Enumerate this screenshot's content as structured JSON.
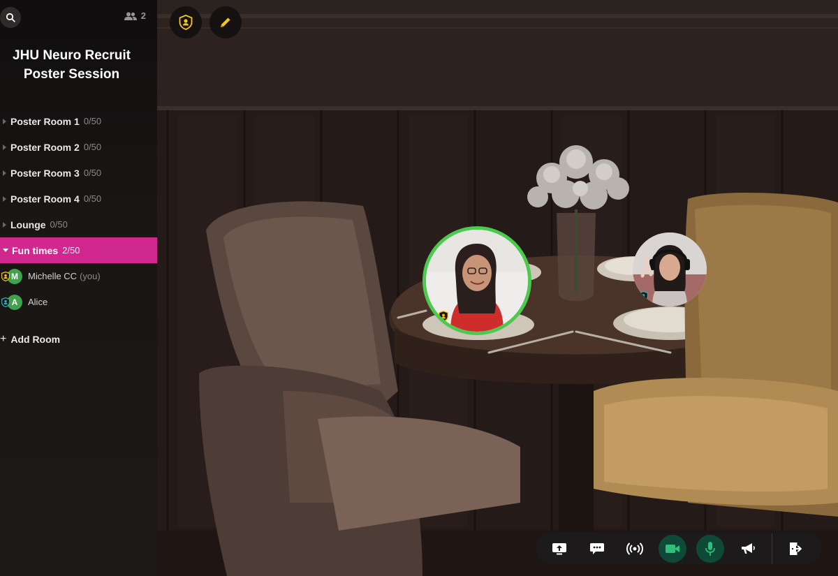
{
  "sidebar": {
    "title": "JHU Neuro Recruit Poster Session",
    "users_count": "2",
    "rooms": [
      {
        "name": "Poster Room 1",
        "count": "0/50"
      },
      {
        "name": "Poster Room 2",
        "count": "0/50"
      },
      {
        "name": "Poster Room 3",
        "count": "0/50"
      },
      {
        "name": "Poster Room 4",
        "count": "0/50"
      },
      {
        "name": "Lounge",
        "count": "0/50"
      },
      {
        "name": "Fun times",
        "count": "2/50"
      }
    ],
    "members": [
      {
        "initial": "M",
        "name": "Michelle CC",
        "suffix": "(you)"
      },
      {
        "initial": "A",
        "name": "Alice",
        "suffix": ""
      }
    ],
    "add_room_label": "Add Room"
  },
  "colors": {
    "active_room": "#d0288f",
    "avatar_green": "#3fa34d",
    "speaking_ring": "#4cc94f",
    "accent_yellow": "#f5c518",
    "on_green": "#2fbf7a"
  },
  "toolbar": {
    "buttons": [
      "share-screen-icon",
      "chat-icon",
      "broadcast-icon",
      "camera-icon",
      "microphone-icon",
      "megaphone-icon",
      "leave-icon"
    ]
  }
}
